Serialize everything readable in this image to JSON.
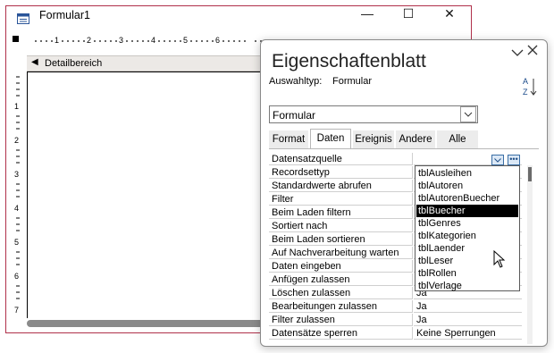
{
  "form_window": {
    "title": "Formular1",
    "minimize": "—",
    "maximize": "☐",
    "close": "✕",
    "section_label": "Detailbereich",
    "ruler_h_numbers": [
      "1",
      "2",
      "3",
      "4",
      "5",
      "6"
    ],
    "ruler_v_numbers": [
      "1",
      "2",
      "3",
      "4",
      "5",
      "6",
      "7"
    ]
  },
  "property_sheet": {
    "title": "Eigenschaftenblatt",
    "selection_type_label": "Auswahltyp:",
    "selection_type_value": "Formular",
    "object_combo_value": "Formular",
    "tabs": [
      {
        "label": "Format",
        "active": false
      },
      {
        "label": "Daten",
        "active": true
      },
      {
        "label": "Ereignis",
        "active": false
      },
      {
        "label": "Andere",
        "active": false
      },
      {
        "label": "Alle",
        "active": false
      }
    ],
    "properties": [
      {
        "name": "Datensatzquelle",
        "value": ""
      },
      {
        "name": "Recordsettyp",
        "value": ""
      },
      {
        "name": "Standardwerte abrufen",
        "value": ""
      },
      {
        "name": "Filter",
        "value": ""
      },
      {
        "name": "Beim Laden filtern",
        "value": ""
      },
      {
        "name": "Sortiert nach",
        "value": ""
      },
      {
        "name": "Beim Laden sortieren",
        "value": ""
      },
      {
        "name": "Auf Nachverarbeitung warten",
        "value": ""
      },
      {
        "name": "Daten eingeben",
        "value": ""
      },
      {
        "name": "Anfügen zulassen",
        "value": ""
      },
      {
        "name": "Löschen zulassen",
        "value": "Ja"
      },
      {
        "name": "Bearbeitungen zulassen",
        "value": "Ja"
      },
      {
        "name": "Filter zulassen",
        "value": "Ja"
      },
      {
        "name": "Datensätze sperren",
        "value": "Keine Sperrungen"
      }
    ],
    "dropdown_items": [
      {
        "label": "tblAusleihen",
        "selected": false
      },
      {
        "label": "tblAutoren",
        "selected": false
      },
      {
        "label": "tblAutorenBuecher",
        "selected": false
      },
      {
        "label": "tblBuecher",
        "selected": true
      },
      {
        "label": "tblGenres",
        "selected": false
      },
      {
        "label": "tblKategorien",
        "selected": false
      },
      {
        "label": "tblLaender",
        "selected": false
      },
      {
        "label": "tblLeser",
        "selected": false
      },
      {
        "label": "tblRollen",
        "selected": false
      },
      {
        "label": "tblVerlage",
        "selected": false
      }
    ]
  }
}
